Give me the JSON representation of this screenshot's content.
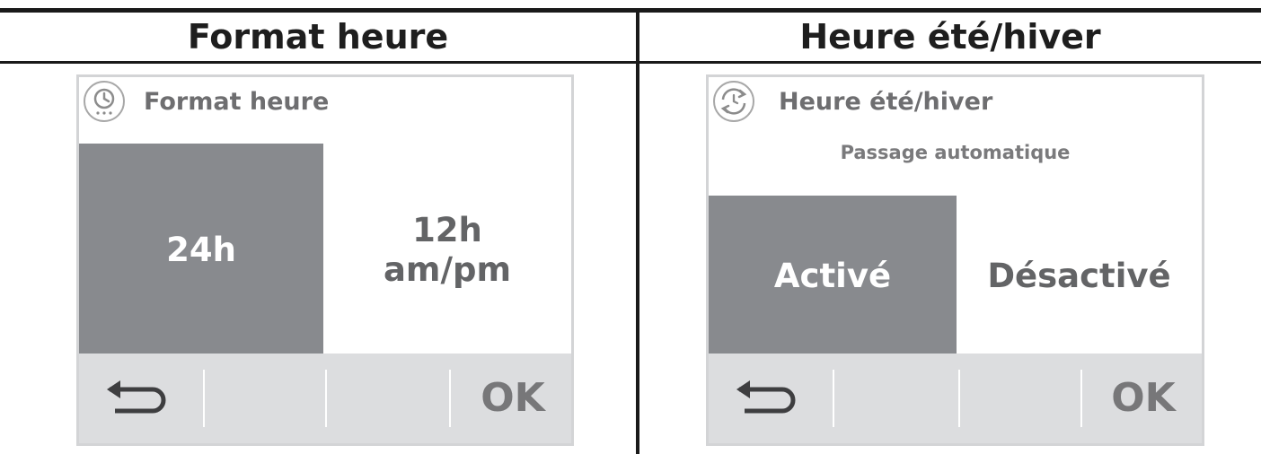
{
  "panels": [
    {
      "heading": "Format heure",
      "screen": {
        "icon": "clock-icon",
        "title": "Format heure",
        "options": [
          {
            "label": "24h",
            "selected": true
          },
          {
            "label_line1": "12h",
            "label_line2": "am/pm",
            "selected": false
          }
        ],
        "footer": {
          "back_icon": "back-arrow-icon",
          "ok_label": "OK"
        }
      }
    },
    {
      "heading": "Heure été/hiver",
      "screen": {
        "icon": "clock-sync-icon",
        "title": "Heure été/hiver",
        "subtitle": "Passage automatique",
        "options": [
          {
            "label": "Activé",
            "selected": true
          },
          {
            "label": "Désactivé",
            "selected": false
          }
        ],
        "footer": {
          "back_icon": "back-arrow-icon",
          "ok_label": "OK"
        }
      }
    }
  ],
  "colors": {
    "selected_bg": "#888a8e",
    "footer_bg": "#dcdddf",
    "frame_border": "#d3d4d6",
    "title_text": "#6e6e70"
  }
}
